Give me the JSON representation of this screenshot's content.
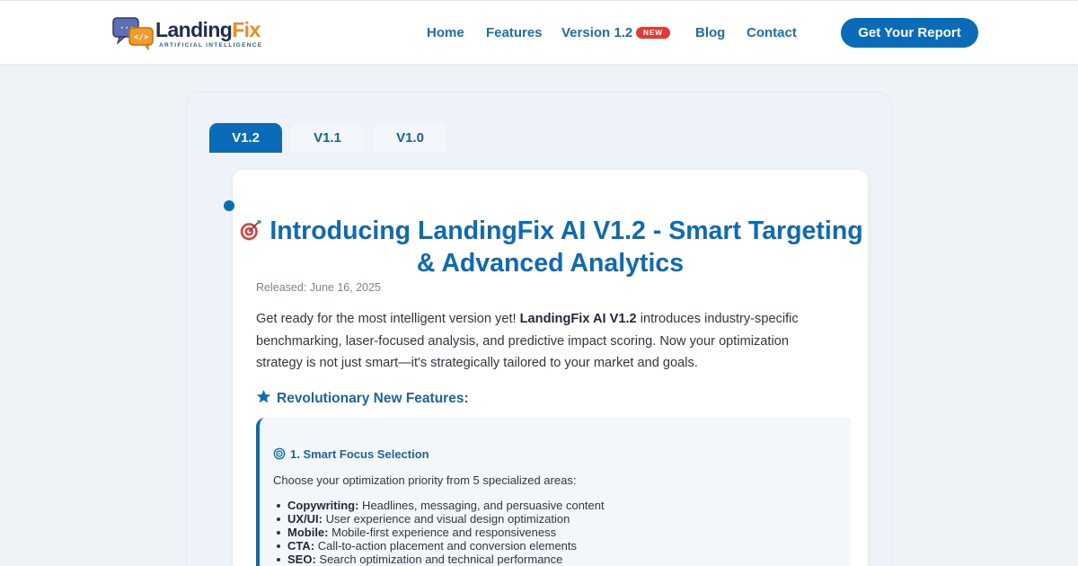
{
  "brand": {
    "name_part1": "Landing",
    "name_part2": "Fix",
    "tagline": "ARTIFICIAL INTELLIGENCE"
  },
  "nav": {
    "items": [
      {
        "label": "Home"
      },
      {
        "label": "Features"
      },
      {
        "label": "Version 1.2"
      },
      {
        "label": "Blog"
      },
      {
        "label": "Contact"
      }
    ],
    "new_badge": "NEW",
    "cta_label": "Get Your Report"
  },
  "tabs": [
    {
      "label": "V1.2",
      "active": true
    },
    {
      "label": "V1.1",
      "active": false
    },
    {
      "label": "V1.0",
      "active": false
    }
  ],
  "release": {
    "title": "Introducing LandingFix AI V1.2 - Smart Targeting & Advanced Analytics",
    "released": "Released: June 16, 2025",
    "intro_before": "Get ready for the most intelligent version yet! ",
    "intro_bold": "LandingFix AI V1.2",
    "intro_after": " introduces industry-specific benchmarking, laser-focused analysis, and predictive impact scoring. Now your optimization strategy is not just smart—it's strategically tailored to your market and goals.",
    "features_heading": "Revolutionary New Features:",
    "feature_1": {
      "title": "1. Smart Focus Selection",
      "description": "Choose your optimization priority from 5 specialized areas:",
      "areas": [
        {
          "name": "Copywriting:",
          "text": " Headlines, messaging, and persuasive content"
        },
        {
          "name": "UX/UI:",
          "text": " User experience and visual design optimization"
        },
        {
          "name": "Mobile:",
          "text": " Mobile-first experience and responsiveness"
        },
        {
          "name": "CTA:",
          "text": " Call-to-action placement and conversion elements"
        },
        {
          "name": "SEO:",
          "text": " Search optimization and technical performance"
        }
      ]
    }
  },
  "colors": {
    "primary": "#0a6cb8",
    "accent_orange": "#f08c1e",
    "badge_red": "#e53935",
    "page_bg": "#eef3f8"
  },
  "icons": {
    "logo": "chat-bubbles-code-icon",
    "title": "dart-target-icon",
    "section": "star-icon",
    "feature": "target-ring-icon"
  }
}
